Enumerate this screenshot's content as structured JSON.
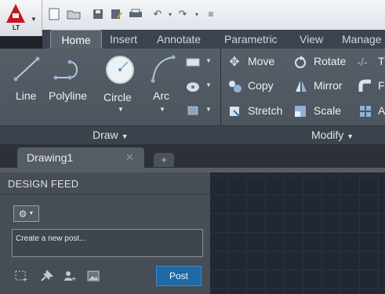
{
  "app": {
    "badge": "LT"
  },
  "quick_access": {
    "icons": [
      "new-icon",
      "open-icon",
      "save-icon",
      "save-as-icon",
      "plot-icon",
      "undo-icon",
      "redo-icon",
      "customize-icon"
    ]
  },
  "ribbon": {
    "tabs": [
      "Home",
      "Insert",
      "Annotate",
      "Parametric",
      "View",
      "Manage"
    ],
    "active_tab": "Home",
    "draw": {
      "title": "Draw",
      "tools": [
        "Line",
        "Polyline",
        "Circle",
        "Arc"
      ]
    },
    "modify": {
      "title": "Modify",
      "tools": [
        "Move",
        "Rotate",
        "Copy",
        "Mirror",
        "Stretch",
        "Scale"
      ]
    }
  },
  "file_tabs": {
    "active": "Drawing1",
    "new_tab": "+"
  },
  "design_feed": {
    "title": "DESIGN FEED",
    "post_placeholder": "Create a new post...",
    "post_button": "Post"
  },
  "colors": {
    "accent_blue": "#1f69a7",
    "logo_red": "#c4161c",
    "canvas": "#222833"
  }
}
